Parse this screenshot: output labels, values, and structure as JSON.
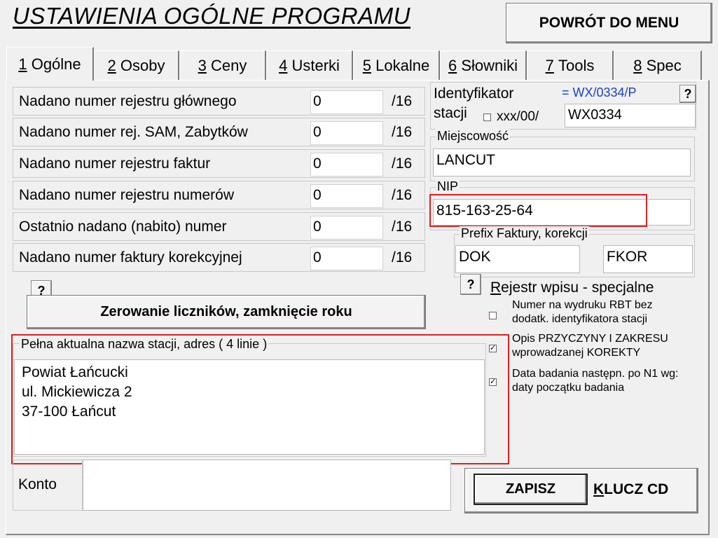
{
  "header": {
    "title": "USTAWIENIA OGÓLNE  PROGRAMU",
    "back_button": "POWRÓT DO MENU"
  },
  "tabs": [
    {
      "num": "1",
      "label": "Ogólne",
      "active": true
    },
    {
      "num": "2",
      "label": "Osoby"
    },
    {
      "num": "3",
      "label": "Ceny"
    },
    {
      "num": "4",
      "label": "Usterki"
    },
    {
      "num": "5",
      "label": "Lokalne"
    },
    {
      "num": "6",
      "label": "Słowniki"
    },
    {
      "num": "7",
      "label": "Tools"
    },
    {
      "num": "8",
      "label": "Spec"
    }
  ],
  "counters": [
    {
      "label": "Nadano numer rejestru głównego",
      "value": "0",
      "suffix": "/16"
    },
    {
      "label": "Nadano numer rej. SAM, Zabytków",
      "value": "0",
      "suffix": "/16"
    },
    {
      "label": "Nadano numer rejestru faktur",
      "value": "0",
      "suffix": "/16"
    },
    {
      "label": "Nadano numer rejestru numerów",
      "value": "0",
      "suffix": "/16"
    },
    {
      "label": "Ostatnio nadano (nabito) numer",
      "value": "0",
      "suffix": "/16"
    },
    {
      "label": "Nadano numer faktury korekcyjnej",
      "value": "0",
      "suffix": "/16"
    }
  ],
  "station": {
    "label_line1": "Identyfikator",
    "label_line2": "stacji",
    "preview": "= WX/0334/P",
    "checkbox_label": "xxx/00/",
    "value": "WX0334",
    "help": "?"
  },
  "city": {
    "label": "Miejscowość",
    "value": "LANCUT"
  },
  "nip": {
    "label": "NIP",
    "value": "815-163-25-64"
  },
  "prefix": {
    "label": "Prefix Faktury,  korekcji",
    "invoice": "DOK",
    "correction": "FKOR"
  },
  "help_mark": "?",
  "reset_button": "Zerowanie liczników,  zamknięcie roku",
  "special": {
    "heading": "Rejestr wpisu - specjalne",
    "options": [
      {
        "line1": "Numer na wydruku RBT bez",
        "line2": "dodatk. identyfikatora stacji",
        "checked": false
      },
      {
        "line1": "Opis PRZYCZYNY I ZAKRESU",
        "line2": "wprowadzanej KOREKTY",
        "checked": true
      },
      {
        "line1": "Data badania następn. po N1 wg:",
        "line2": "daty początku badania",
        "checked": true
      }
    ]
  },
  "address": {
    "label": "Pełna aktualna nazwa stacji, adres ( 4 linie )",
    "lines": [
      "Powiat Łańcucki",
      "ul. Mickiewicza 2",
      "37-100 Łańcut",
      ""
    ]
  },
  "account": {
    "label": "Konto",
    "value": ""
  },
  "save_button": "ZAPISZ",
  "cd_key_button": "KLUCZ CD",
  "colors": {
    "highlight": "#e02020",
    "preview_text": "#1a3fd0"
  }
}
